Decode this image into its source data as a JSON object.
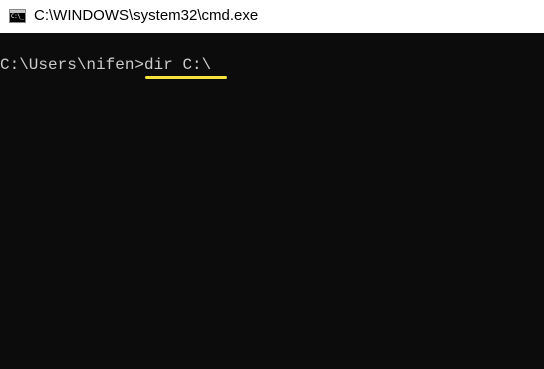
{
  "window": {
    "title": "C:\\WINDOWS\\system32\\cmd.exe",
    "icon_name": "cmd-icon",
    "icon_label": "C:\\_"
  },
  "console": {
    "prompt": "C:\\Users\\nifen>",
    "command": "dir C:\\",
    "highlight_color": "#f5e23a",
    "background_color": "#0c0c0c",
    "text_color": "#cccccc"
  }
}
